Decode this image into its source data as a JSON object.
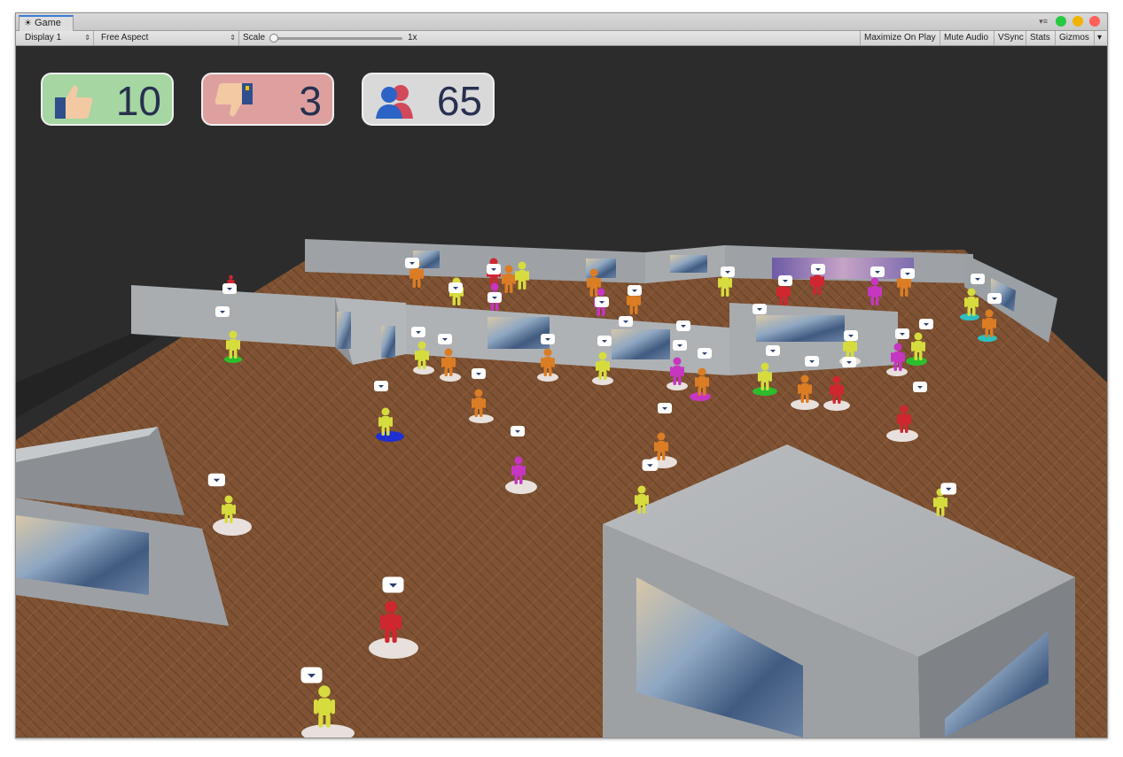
{
  "window": {
    "tab_label": "Game",
    "tab_icon": "unity-logo-icon",
    "window_controls": {
      "menu": "▾≡",
      "colors": [
        "#27c93f",
        "#f0b400",
        "#ff5f57"
      ]
    }
  },
  "toolbar": {
    "display": "Display 1",
    "aspect": "Free Aspect",
    "scale_label": "Scale",
    "scale_value": "1x",
    "buttons": [
      "Maximize On Play",
      "Mute Audio",
      "VSync",
      "Stats",
      "Gizmos"
    ],
    "gizmos_arrow": "▾"
  },
  "hud": {
    "likes": {
      "value": "10",
      "icon": "thumbs-up-icon",
      "bg": "#a6d6a2"
    },
    "dislikes": {
      "value": "3",
      "icon": "thumbs-down-icon",
      "bg": "#dea09f"
    },
    "visitors": {
      "value": "65",
      "icon": "people-icon",
      "bg": "#d9d9d9"
    }
  },
  "colors": {
    "floor": "#7e5233",
    "wall": "#b6b9bc",
    "void": "#2c2c2c",
    "agent_yellow": "#d6dc3e",
    "agent_orange": "#da7d24",
    "agent_red": "#cf2630",
    "agent_magenta": "#c636c0"
  }
}
